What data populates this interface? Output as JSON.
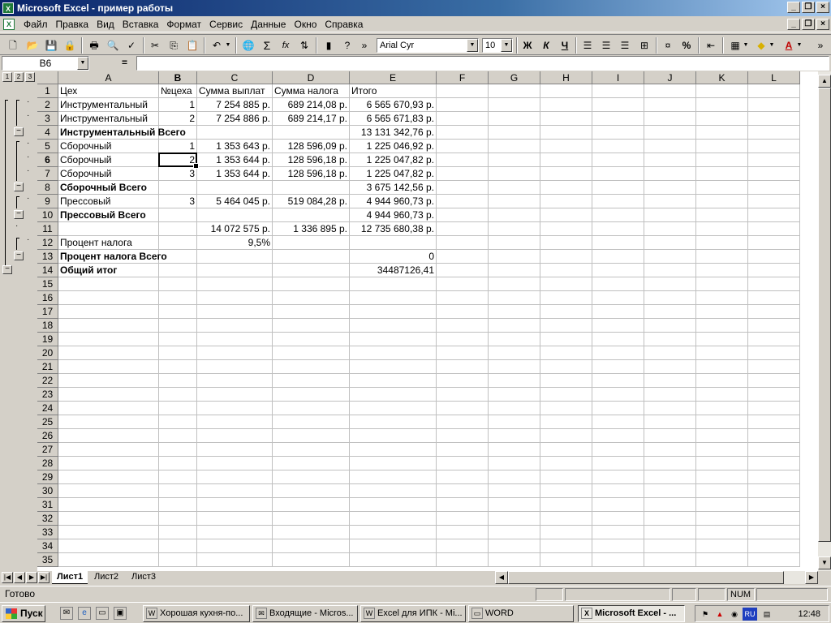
{
  "window": {
    "title": "Microsoft Excel - пример работы"
  },
  "menu": [
    "Файл",
    "Правка",
    "Вид",
    "Вставка",
    "Формат",
    "Сервис",
    "Данные",
    "Окно",
    "Справка"
  ],
  "toolbar": {
    "font_name": "Arial Cyr",
    "font_size": "10",
    "bold": "Ж",
    "italic": "К",
    "underline": "Ч",
    "percent": "%",
    "sigma": "Σ",
    "fx": "fx",
    "more": "»"
  },
  "formula": {
    "cell_ref": "B6",
    "eq": "=",
    "content": ""
  },
  "outline": {
    "levels": [
      "1",
      "2",
      "3"
    ]
  },
  "columns": [
    "A",
    "B",
    "C",
    "D",
    "E",
    "F",
    "G",
    "H",
    "I",
    "J",
    "K",
    "L"
  ],
  "selected": {
    "row": 6,
    "col": "B"
  },
  "rows": [
    {
      "n": "1",
      "cells": [
        "Цех",
        "№цеха",
        "Сумма выплат",
        "Сумма налога",
        "Итого"
      ],
      "bold": false
    },
    {
      "n": "2",
      "cells": [
        "Инструментальный",
        "1",
        "7 254 885 р.",
        "689 214,08 р.",
        "6 565 670,93 р."
      ],
      "bold": false
    },
    {
      "n": "3",
      "cells": [
        "Инструментальный",
        "2",
        "7 254 886 р.",
        "689 214,17 р.",
        "6 565 671,83 р."
      ],
      "bold": false
    },
    {
      "n": "4",
      "cells": [
        "Инструментальный Всего",
        "",
        "",
        "",
        "13 131 342,76 р."
      ],
      "bold": true
    },
    {
      "n": "5",
      "cells": [
        "Сборочный",
        "1",
        "1 353 643 р.",
        "128 596,09 р.",
        "1 225 046,92 р."
      ],
      "bold": false
    },
    {
      "n": "6",
      "cells": [
        "Сборочный",
        "2",
        "1 353 644 р.",
        "128 596,18 р.",
        "1 225 047,82 р."
      ],
      "bold": false
    },
    {
      "n": "7",
      "cells": [
        "Сборочный",
        "3",
        "1 353 644 р.",
        "128 596,18 р.",
        "1 225 047,82 р."
      ],
      "bold": false
    },
    {
      "n": "8",
      "cells": [
        "Сборочный Всего",
        "",
        "",
        "",
        "3 675 142,56 р."
      ],
      "bold": true
    },
    {
      "n": "9",
      "cells": [
        "Прессовый",
        "3",
        "5 464 045 р.",
        "519 084,28 р.",
        "4 944 960,73 р."
      ],
      "bold": false
    },
    {
      "n": "10",
      "cells": [
        "Прессовый Всего",
        "",
        "",
        "",
        "4 944 960,73 р."
      ],
      "bold": true
    },
    {
      "n": "11",
      "cells": [
        "",
        "",
        "14 072 575 р.",
        "1 336 895 р.",
        "12 735 680,38 р."
      ],
      "bold": false
    },
    {
      "n": "12",
      "cells": [
        "Процент налога",
        "",
        "9,5%",
        "",
        ""
      ],
      "bold": false
    },
    {
      "n": "13",
      "cells": [
        "Процент налога Всего",
        "",
        "",
        "",
        "0"
      ],
      "bold": true
    },
    {
      "n": "14",
      "cells": [
        "Общий итог",
        "",
        "",
        "",
        "34487126,41"
      ],
      "bold": true
    },
    {
      "n": "15",
      "cells": []
    },
    {
      "n": "16",
      "cells": []
    },
    {
      "n": "17",
      "cells": []
    },
    {
      "n": "18",
      "cells": []
    },
    {
      "n": "19",
      "cells": []
    },
    {
      "n": "20",
      "cells": []
    },
    {
      "n": "21",
      "cells": []
    },
    {
      "n": "22",
      "cells": []
    },
    {
      "n": "23",
      "cells": []
    },
    {
      "n": "24",
      "cells": []
    },
    {
      "n": "25",
      "cells": []
    },
    {
      "n": "26",
      "cells": []
    },
    {
      "n": "27",
      "cells": []
    },
    {
      "n": "28",
      "cells": []
    },
    {
      "n": "29",
      "cells": []
    },
    {
      "n": "30",
      "cells": []
    },
    {
      "n": "31",
      "cells": []
    },
    {
      "n": "32",
      "cells": []
    },
    {
      "n": "33",
      "cells": []
    },
    {
      "n": "34",
      "cells": []
    },
    {
      "n": "35",
      "cells": []
    }
  ],
  "sheets": [
    "Лист1",
    "Лист2",
    "Лист3"
  ],
  "status": {
    "text": "Готово",
    "num": "NUM"
  },
  "taskbar": {
    "start": "Пуск",
    "tasks": [
      "Хорошая кухня-по...",
      "Входящие - Micros...",
      "Excel для ИПК - Mi...",
      "WORD",
      "Microsoft Excel - ..."
    ],
    "lang": "RU",
    "clock": "12:48"
  }
}
